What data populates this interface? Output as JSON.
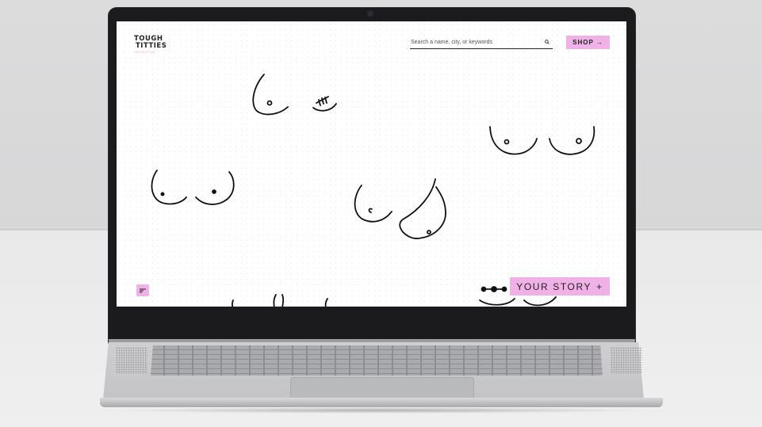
{
  "site": {
    "logo_line1": "TOUGH",
    "logo_line2": "TITTIES",
    "logo_tagline": "COLLECTIVE"
  },
  "search": {
    "placeholder": "Search a name, city, or keywords",
    "icon": "search-icon"
  },
  "buttons": {
    "shop_label": "SHOP",
    "shop_arrow": "→",
    "story_label": "YOUR STORY",
    "story_plus": "+",
    "filter_icon": "filter-icon"
  },
  "colors": {
    "accent_pink": "#f0b1e6",
    "ink": "#111111"
  }
}
